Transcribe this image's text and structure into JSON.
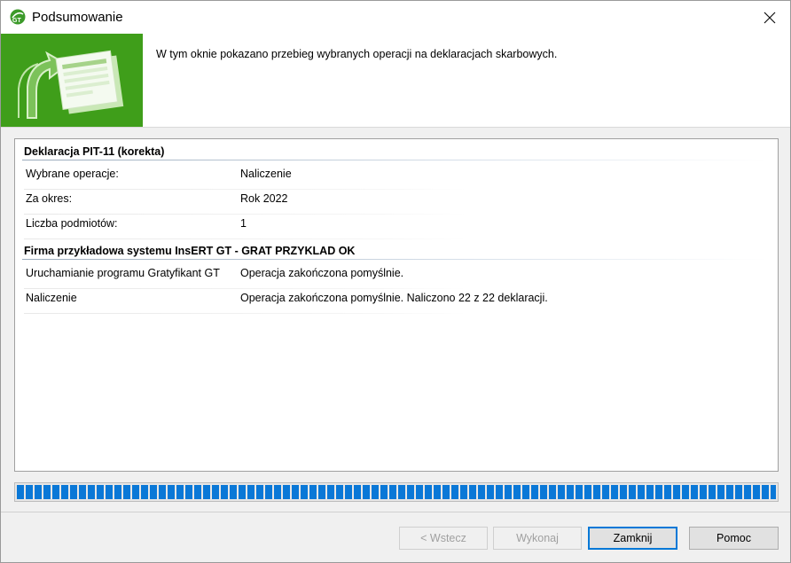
{
  "window": {
    "title": "Podsumowanie",
    "icon": "gt-app-icon"
  },
  "header": {
    "description": "W tym oknie pokazano przebieg wybranych operacji na deklaracjach skarbowych."
  },
  "groups": [
    {
      "title": "Deklaracja PIT-11 (korekta)",
      "rows": [
        {
          "label": "Wybrane operacje:",
          "value": "Naliczenie"
        },
        {
          "label": "Za okres:",
          "value": "Rok 2022"
        },
        {
          "label": "Liczba podmiotów:",
          "value": "1"
        }
      ]
    },
    {
      "title": "Firma przykładowa systemu InsERT GT - GRAT PRZYKLAD OK",
      "rows": [
        {
          "label": "Uruchamianie programu Gratyfikant GT",
          "value": "Operacja zakończona pomyślnie."
        },
        {
          "label": "Naliczenie",
          "value": "Operacja zakończona pomyślnie. Naliczono 22 z 22 deklaracji."
        }
      ]
    }
  ],
  "progress": {
    "value_fraction": 1.0,
    "color": "#0a78d7"
  },
  "buttons": {
    "back": "< Wstecz",
    "execute": "Wykonaj",
    "close": "Zamknij",
    "help": "Pomoc"
  },
  "colors": {
    "banner": "#3f9e1a",
    "accent": "#0078d7"
  }
}
